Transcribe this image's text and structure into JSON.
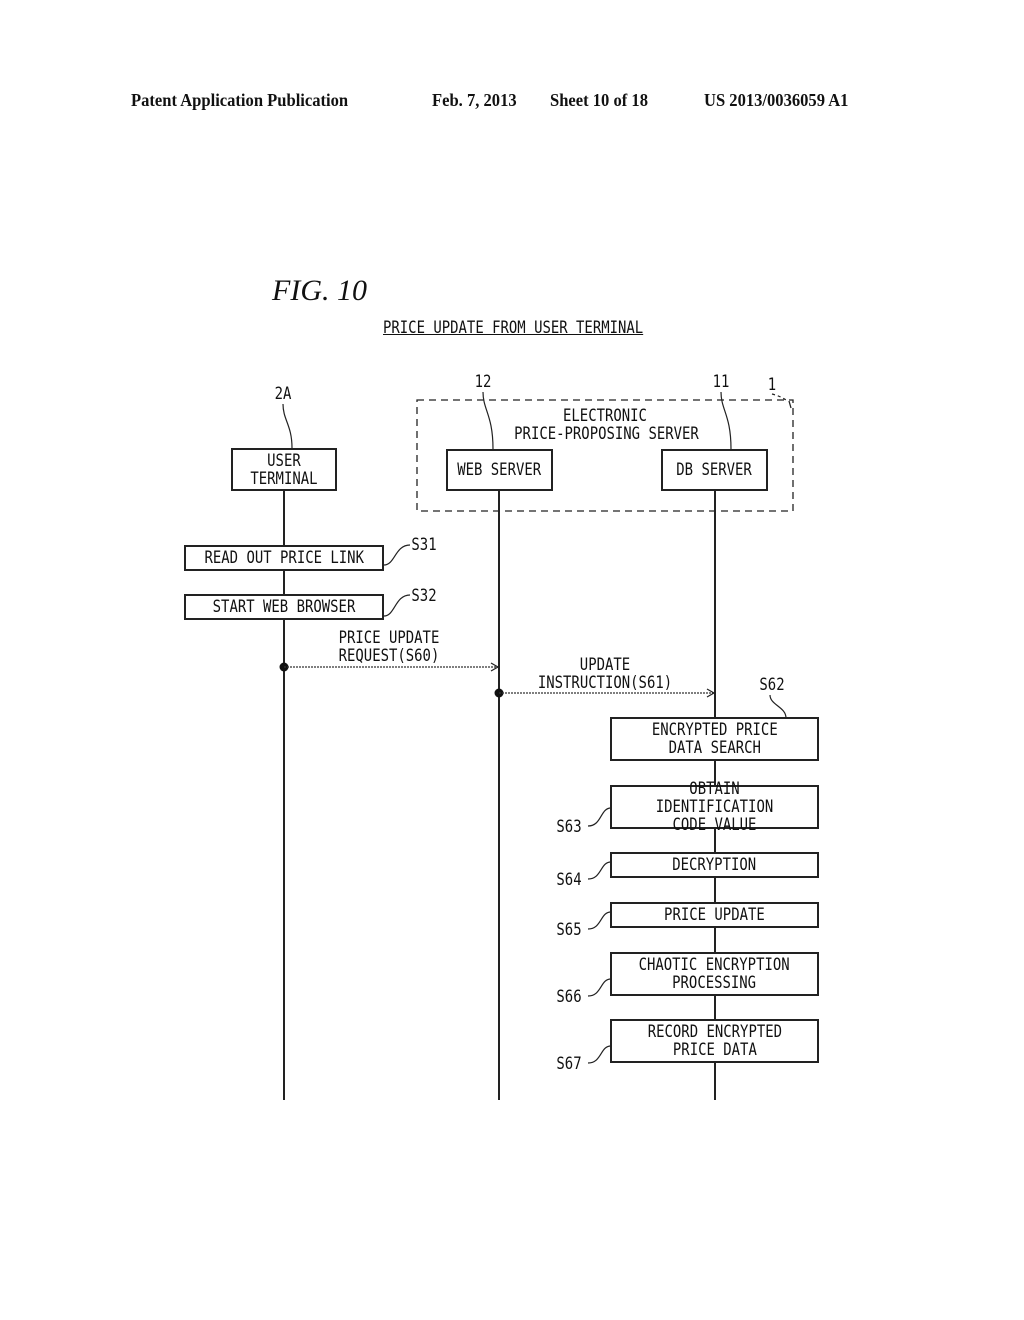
{
  "header": {
    "publication": "Patent Application Publication",
    "date": "Feb. 7, 2013",
    "sheet": "Sheet 10 of 18",
    "number": "US 2013/0036059 A1"
  },
  "figure": {
    "label": "FIG. 10",
    "title": "PRICE UPDATE FROM USER TERMINAL"
  },
  "system": {
    "ref": "1",
    "name_line1": "ELECTRONIC",
    "name_line2": "PRICE-PROPOSING SERVER"
  },
  "lifelines": [
    {
      "ref": "2A",
      "label": "USER\nTERMINAL"
    },
    {
      "ref": "12",
      "label": "WEB SERVER"
    },
    {
      "ref": "11",
      "label": "DB SERVER"
    }
  ],
  "user_steps": [
    {
      "id": "S31",
      "label": "READ OUT PRICE LINK"
    },
    {
      "id": "S32",
      "label": "START WEB BROWSER"
    }
  ],
  "messages": [
    {
      "line1": "PRICE UPDATE",
      "line2": "REQUEST(S60)"
    },
    {
      "line1": "UPDATE",
      "line2": "INSTRUCTION(S61)"
    }
  ],
  "db_steps": [
    {
      "id": "S62",
      "label": "ENCRYPTED PRICE\nDATA SEARCH"
    },
    {
      "id": "S63",
      "label": "OBTAIN IDENTIFICATION\nCODE VALUE"
    },
    {
      "id": "S64",
      "label": "DECRYPTION"
    },
    {
      "id": "S65",
      "label": "PRICE UPDATE"
    },
    {
      "id": "S66",
      "label": "CHAOTIC ENCRYPTION\nPROCESSING"
    },
    {
      "id": "S67",
      "label": "RECORD ENCRYPTED\nPRICE DATA"
    }
  ]
}
